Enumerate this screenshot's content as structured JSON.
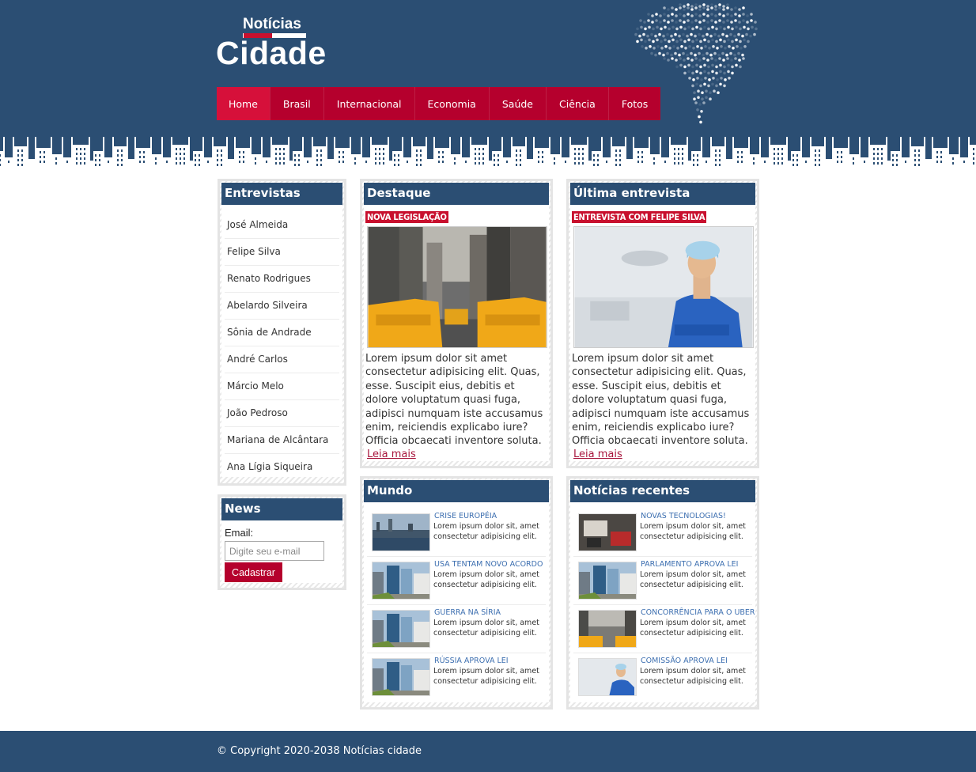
{
  "logo": {
    "top_text": "Notícias",
    "main_text": "Cidade"
  },
  "nav": {
    "items": [
      "Home",
      "Brasil",
      "Internacional",
      "Economia",
      "Saúde",
      "Ciência",
      "Fotos"
    ]
  },
  "colors": {
    "header": "#2b4e73",
    "accent": "#c8102e",
    "nav": "#b5002d",
    "link": "#3d6fb0"
  },
  "entrevistas": {
    "title": "Entrevistas",
    "items": [
      "José Almeida",
      "Felipe Silva",
      "Renato Rodrigues",
      "Abelardo Silveira",
      "Sônia de Andrade",
      "André Carlos",
      "Márcio Melo",
      "João Pedroso",
      "Mariana de Alcântara",
      "Ana Lígia Siqueira"
    ]
  },
  "news_box": {
    "title": "News",
    "email_label": "Email:",
    "email_placeholder": "Digite seu e-mail",
    "submit_label": "Cadastrar"
  },
  "destaque": {
    "title": "Destaque",
    "tag": "NOVA LEGISLAÇÃO",
    "text": "Lorem ipsum dolor sit amet consectetur adipisicing elit. Quas, esse. Suscipit eius, debitis et dolore voluptatum quasi fuga, adipisci numquam iste accusamus enim, reiciendis explicabo iure? Officia obcaecati inventore soluta.",
    "link": "Leia mais"
  },
  "ultima": {
    "title": "Última entrevista",
    "tag": "ENTREVISTA COM FELIPE SILVA",
    "text": "Lorem ipsum dolor sit amet consectetur adipisicing elit. Quas, esse. Suscipit eius, debitis et dolore voluptatum quasi fuga, adipisci numquam iste accusamus enim, reiciendis explicabo iure? Officia obcaecati inventore soluta.",
    "link": "Leia mais"
  },
  "mundo": {
    "title": "Mundo",
    "items": [
      {
        "title": "CRISE EUROPÉIA",
        "text": "Lorem ipsum dolor sit, amet consectetur adipisicing elit.",
        "thumb": "city-river"
      },
      {
        "title": "USA TENTAM NOVO ACORDO",
        "text": "Lorem ipsum dolor sit, amet consectetur adipisicing elit.",
        "thumb": "buildings"
      },
      {
        "title": "GUERRA NA SÍRIA",
        "text": "Lorem ipsum dolor sit, amet consectetur adipisicing elit.",
        "thumb": "buildings"
      },
      {
        "title": "RÚSSIA APROVA LEI",
        "text": "Lorem ipsum dolor sit, amet consectetur adipisicing elit.",
        "thumb": "buildings"
      }
    ]
  },
  "recentes": {
    "title": "Notícias recentes",
    "items": [
      {
        "title": "NOVAS TECNOLOGIAS!",
        "text": "Lorem ipsum dolor sit, amet consectetur adipisicing elit.",
        "thumb": "desk"
      },
      {
        "title": "PARLAMENTO APROVA LEI",
        "text": "Lorem ipsum dolor sit, amet consectetur adipisicing elit.",
        "thumb": "buildings"
      },
      {
        "title": "CONCORRÊNCIA PARA O UBER",
        "text": "Lorem ipsum dolor sit, amet consectetur adipisicing elit.",
        "thumb": "taxi"
      },
      {
        "title": "COMISSÃO APROVA LEI",
        "text": "Lorem ipsum dolor sit, amet consectetur adipisicing elit.",
        "thumb": "doctor"
      }
    ]
  },
  "footer": {
    "text": "© Copyright 2020-2038 Notícias cidade"
  }
}
